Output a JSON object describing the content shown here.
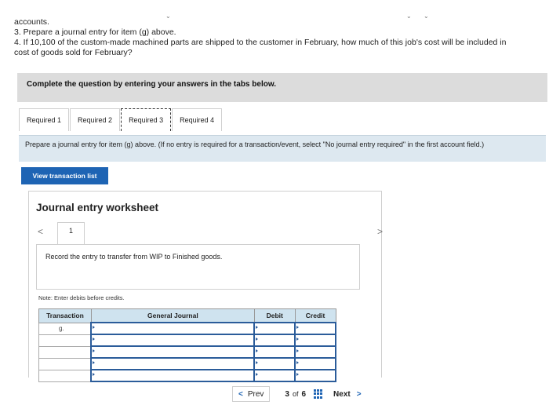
{
  "question": {
    "line1": "accounts.",
    "line2": "3. Prepare a journal entry for item (g) above.",
    "line3": "4. If 10,100 of the custom-made machined parts are shipped to the customer in February, how much of this job's cost will be included in",
    "line4": "cost of goods sold for February?"
  },
  "banner": "Complete the question by entering your answers in the tabs below.",
  "tabs": [
    {
      "label": "Required 1",
      "active": false
    },
    {
      "label": "Required 2",
      "active": false
    },
    {
      "label": "Required 3",
      "active": true
    },
    {
      "label": "Required 4",
      "active": false
    }
  ],
  "prompt": "Prepare a journal entry for item (g) above. (If no entry is required for a transaction/event, select \"No journal entry required\" in the first account field.)",
  "view_button": "View transaction list",
  "worksheet": {
    "title": "Journal entry worksheet",
    "prev_icon": "chevron-left-icon",
    "next_icon": "chevron-right-icon",
    "page_tab": "1",
    "entry_text": "Record the entry to transfer from WIP to Finished goods.",
    "note": "Note: Enter debits before credits.",
    "columns": [
      "Transaction",
      "General Journal",
      "Debit",
      "Credit"
    ],
    "rows": [
      {
        "transaction": "g."
      },
      {
        "transaction": ""
      },
      {
        "transaction": ""
      },
      {
        "transaction": ""
      },
      {
        "transaction": ""
      }
    ]
  },
  "pager": {
    "prev": "Prev",
    "current": "3",
    "of": "of",
    "total": "6",
    "next": "Next",
    "accent": "#1e64b4"
  },
  "indicators": [
    "⌄",
    "⌄",
    "⌄"
  ]
}
